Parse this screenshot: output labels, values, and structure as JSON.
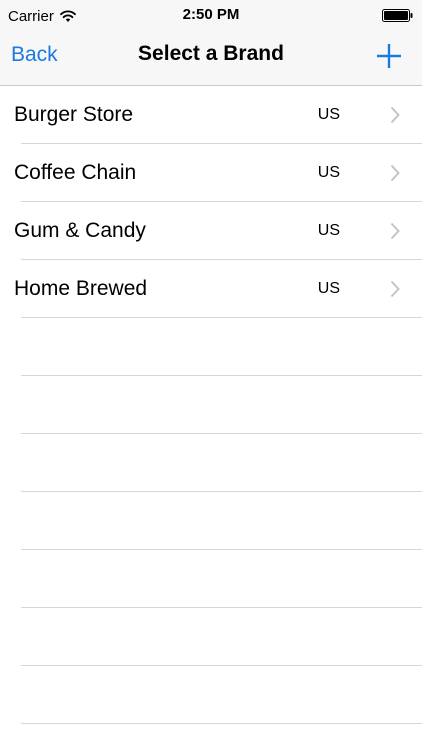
{
  "status_bar": {
    "carrier": "Carrier",
    "time": "2:50 PM",
    "wifi_icon": "wifi-icon",
    "battery_icon": "battery-full-icon"
  },
  "nav": {
    "back_label": "Back",
    "title": "Select a Brand",
    "add_icon": "plus-icon",
    "accent_color": "#1a7ae0"
  },
  "brands": [
    {
      "name": "Burger Store",
      "region": "US"
    },
    {
      "name": "Coffee Chain",
      "region": "US"
    },
    {
      "name": "Gum & Candy",
      "region": "US"
    },
    {
      "name": "Home Brewed",
      "region": "US"
    }
  ]
}
